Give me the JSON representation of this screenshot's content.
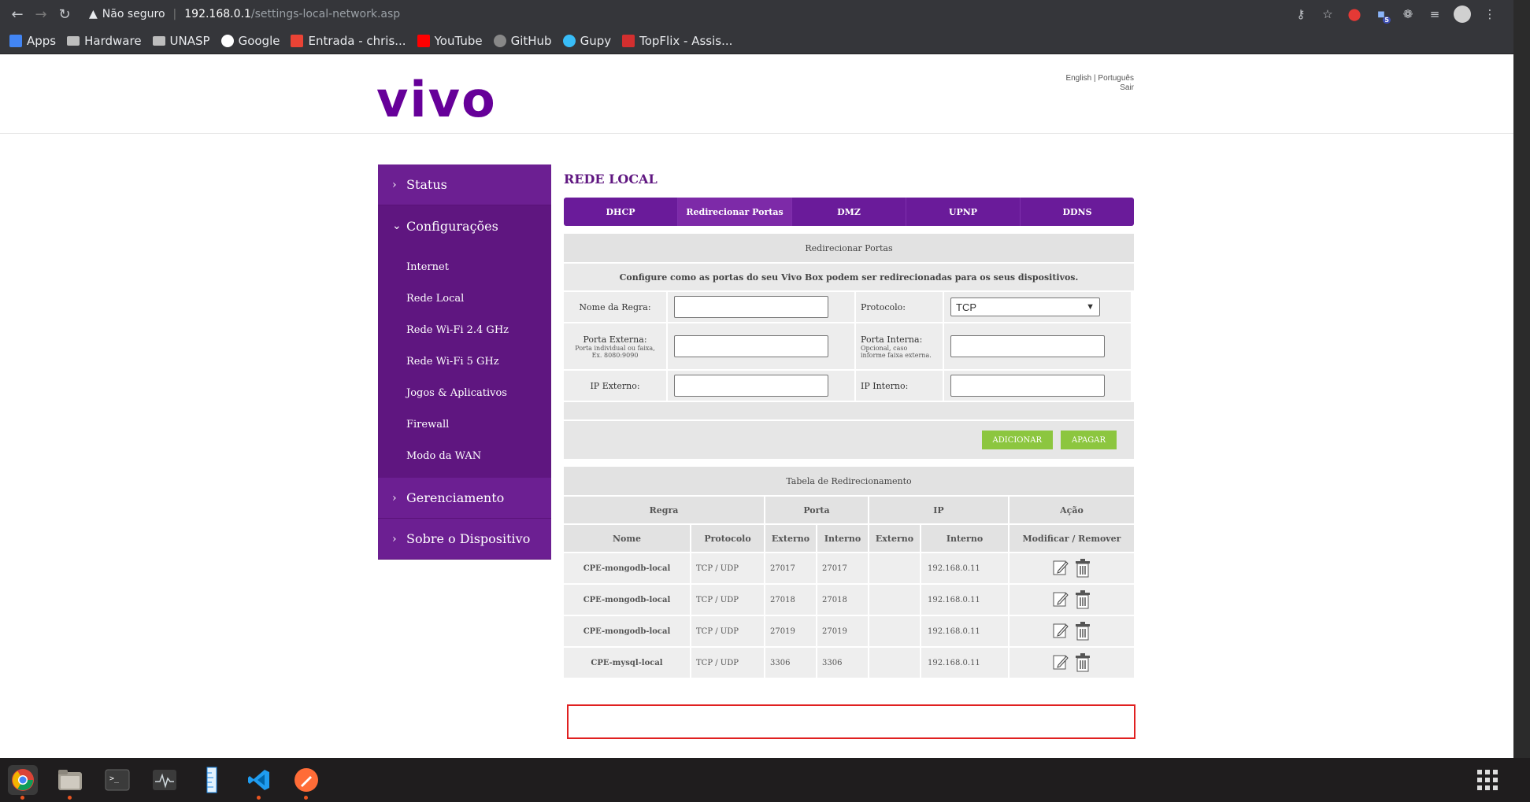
{
  "browser": {
    "security_label": "Não seguro",
    "url_host": "192.168.0.1",
    "url_path": "/settings-local-network.asp",
    "extension_badge": "5"
  },
  "bookmarks": [
    {
      "label": "Apps",
      "icon": "apps-grid-icon",
      "color": "#4285f4"
    },
    {
      "label": "Hardware",
      "icon": "folder-icon",
      "color": "#bdbdbd"
    },
    {
      "label": "UNASP",
      "icon": "folder-icon",
      "color": "#bdbdbd"
    },
    {
      "label": "Google",
      "icon": "google-icon",
      "color": "#ffffff"
    },
    {
      "label": "Entrada - chris...",
      "icon": "gmail-icon",
      "color": "#ea4335"
    },
    {
      "label": "YouTube",
      "icon": "youtube-icon",
      "color": "#ff0000"
    },
    {
      "label": "GitHub",
      "icon": "github-icon",
      "color": "#888888"
    },
    {
      "label": "Gupy",
      "icon": "gupy-icon",
      "color": "#38bdf8"
    },
    {
      "label": "TopFlix - Assis...",
      "icon": "topflix-icon",
      "color": "#d32f2f"
    }
  ],
  "header": {
    "logo": "vivo",
    "lang_english": "English",
    "lang_sep": " | ",
    "lang_portugues": "Português",
    "logout": "Sair"
  },
  "sidebar": {
    "status": "Status",
    "configuracoes": "Configurações",
    "items": [
      "Internet",
      "Rede Local",
      "Rede Wi-Fi 2.4 GHz",
      "Rede Wi-Fi 5 GHz",
      "Jogos & Aplicativos",
      "Firewall",
      "Modo da WAN"
    ],
    "gerenciamento": "Gerenciamento",
    "sobre": "Sobre o Dispositivo"
  },
  "main": {
    "title": "REDE LOCAL",
    "tabs": [
      "DHCP",
      "Redirecionar Portas",
      "DMZ",
      "UPNP",
      "DDNS"
    ],
    "active_tab": 1
  },
  "form": {
    "section_title": "Redirecionar Portas",
    "description": "Configure como as portas do seu Vivo Box podem ser redirecionadas para os seus dispositivos.",
    "nome_regra_label": "Nome da Regra:",
    "protocolo_label": "Protocolo:",
    "protocolo_value": "TCP",
    "porta_externa_label": "Porta Externa:",
    "porta_externa_hint": "Porta individual ou faixa, Ex. 8080:9090",
    "porta_interna_label": "Porta Interna:",
    "porta_interna_hint": "Opcional, caso informe faixa externa.",
    "ip_externo_label": "IP Externo:",
    "ip_interno_label": "IP Interno:",
    "add_button": "ADICIONAR",
    "clear_button": "APAGAR"
  },
  "redirect_table": {
    "title": "Tabela de Redirecionamento",
    "group_headers": {
      "regra": "Regra",
      "porta": "Porta",
      "ip": "IP",
      "acao": "Ação"
    },
    "headers": {
      "nome": "Nome",
      "protocolo": "Protocolo",
      "externo": "Externo",
      "interno": "Interno",
      "ip_externo": "Externo",
      "ip_interno": "Interno",
      "acao": "Modificar / Remover"
    },
    "rows": [
      {
        "nome": "CPE-mongodb-local",
        "protocolo": "TCP / UDP",
        "externo": "27017",
        "interno": "27017",
        "ip_externo": "",
        "ip_interno": "192.168.0.11"
      },
      {
        "nome": "CPE-mongodb-local",
        "protocolo": "TCP / UDP",
        "externo": "27018",
        "interno": "27018",
        "ip_externo": "",
        "ip_interno": "192.168.0.11"
      },
      {
        "nome": "CPE-mongodb-local",
        "protocolo": "TCP / UDP",
        "externo": "27019",
        "interno": "27019",
        "ip_externo": "",
        "ip_interno": "192.168.0.11"
      },
      {
        "nome": "CPE-mysql-local",
        "protocolo": "TCP / UDP",
        "externo": "3306",
        "interno": "3306",
        "ip_externo": "",
        "ip_interno": "192.168.0.11"
      }
    ]
  },
  "colors": {
    "brand_purple": "#660099",
    "sidebar_purple": "#5f1680",
    "button_green": "#8cc63f",
    "highlight_red": "#e02020"
  }
}
